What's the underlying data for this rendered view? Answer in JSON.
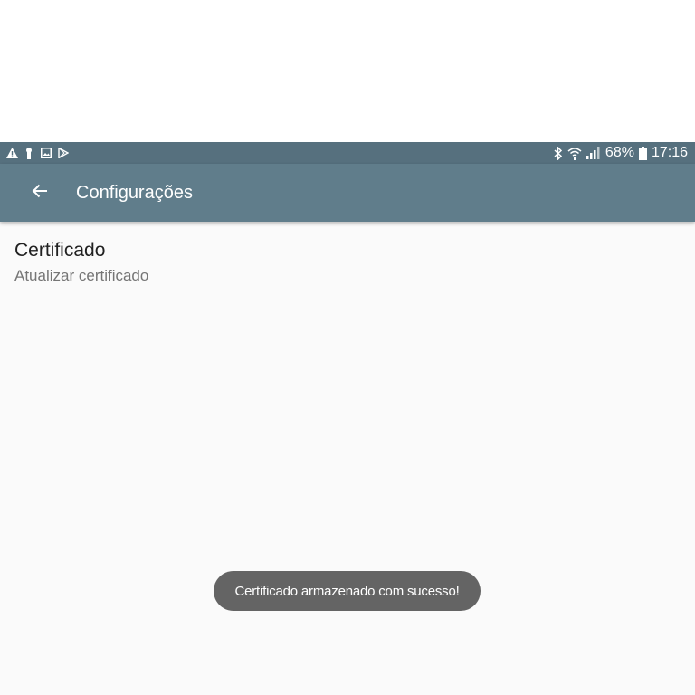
{
  "status_bar": {
    "left_icons": [
      "warning-icon",
      "usb-key-icon",
      "image-icon",
      "play-store-icon"
    ],
    "right_icons": [
      "bluetooth-icon",
      "wifi-icon",
      "signal-icon",
      "battery-icon"
    ],
    "battery_percent": "68%",
    "time": "17:16",
    "background_color": "#56707e"
  },
  "app_bar": {
    "title": "Configurações",
    "back_icon": "arrow-back-icon",
    "background_color": "#607d8b"
  },
  "preferences": [
    {
      "title": "Certificado",
      "summary": "Atualizar certificado"
    }
  ],
  "toast": {
    "message": "Certificado armazenado com sucesso!"
  }
}
